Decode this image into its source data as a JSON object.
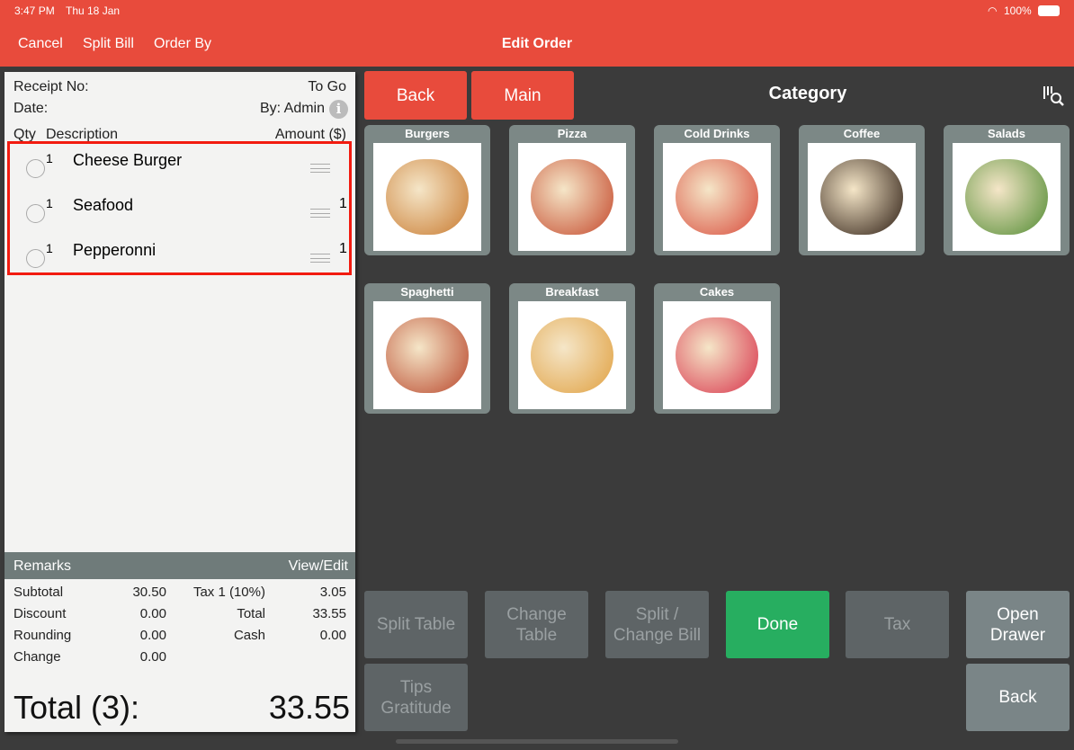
{
  "status": {
    "time": "3:47 PM",
    "date": "Thu 18 Jan",
    "battery": "100%"
  },
  "nav": {
    "cancel": "Cancel",
    "split_bill": "Split Bill",
    "order_by": "Order By",
    "title": "Edit Order"
  },
  "receipt": {
    "receipt_no_label": "Receipt No:",
    "order_type": "To Go",
    "date_label": "Date:",
    "by": "By: Admin",
    "col_qty": "Qty",
    "col_desc": "Description",
    "col_amount": "Amount ($)",
    "items": [
      {
        "qty": "1",
        "name": "Cheese Burger",
        "amount": ""
      },
      {
        "qty": "1",
        "name": "Seafood",
        "amount": "1"
      },
      {
        "qty": "1",
        "name": "Pepperonni",
        "amount": "1"
      }
    ],
    "remarks": "Remarks",
    "view_edit": "View/Edit",
    "subtotal_label": "Subtotal",
    "subtotal": "30.50",
    "tax_label": "Tax 1 (10%)",
    "tax": "3.05",
    "discount_label": "Discount",
    "discount": "0.00",
    "total_label": "Total",
    "total": "33.55",
    "rounding_label": "Rounding",
    "rounding": "0.00",
    "cash_label": "Cash",
    "cash": "0.00",
    "change_label": "Change",
    "change": "0.00",
    "grand_label": "Total (3):",
    "grand": "33.55"
  },
  "menu": {
    "back": "Back",
    "main": "Main",
    "heading": "Category",
    "categories": [
      {
        "name": "Burgers",
        "color": "#c8792e"
      },
      {
        "name": "Pizza",
        "color": "#c4472a"
      },
      {
        "name": "Cold Drinks",
        "color": "#d84a3a"
      },
      {
        "name": "Coffee",
        "color": "#2a1a10"
      },
      {
        "name": "Salads",
        "color": "#4f8a30"
      },
      {
        "name": "Spaghetti",
        "color": "#b8452a"
      },
      {
        "name": "Breakfast",
        "color": "#e0a040"
      },
      {
        "name": "Cakes",
        "color": "#d8324a"
      }
    ]
  },
  "actions": {
    "split_table": "Split Table",
    "change_table": "Change Table",
    "split_change_bill": "Split / Change Bill",
    "done": "Done",
    "tax": "Tax",
    "open_drawer": "Open Drawer",
    "tips": "Tips Gratitude",
    "back": "Back"
  }
}
